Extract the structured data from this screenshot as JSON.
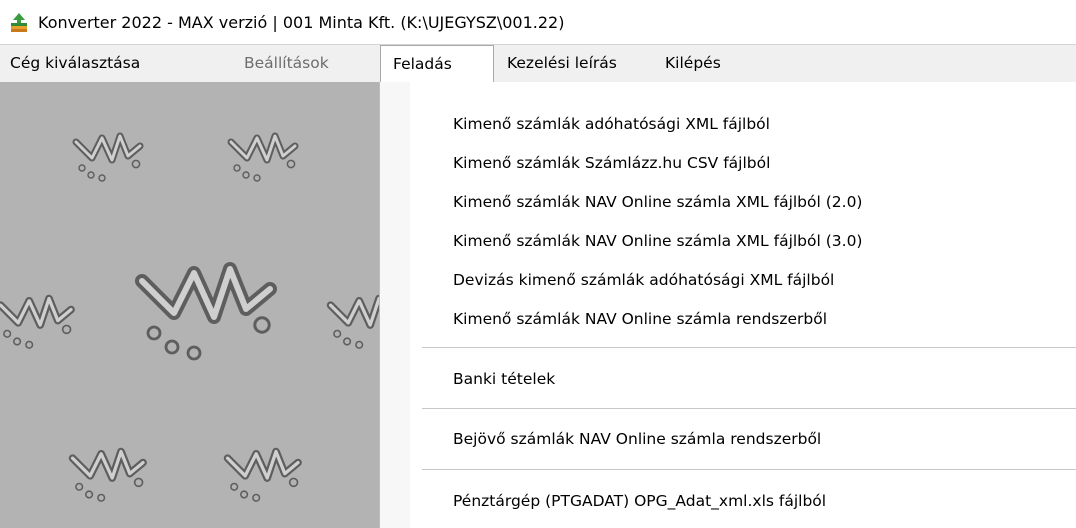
{
  "window": {
    "title": "Konverter 2022 - MAX verzió  | 001 Minta Kft. (K:\\UJEGYSZ\\001.22)",
    "icon": "app-converter-icon"
  },
  "menubar": {
    "items": [
      {
        "label": "Cég kiválasztása",
        "state": "enabled"
      },
      {
        "label": "Beállítások",
        "state": "disabled"
      },
      {
        "label": "Feladás",
        "state": "open"
      },
      {
        "label": "Kezelési leírás",
        "state": "enabled"
      },
      {
        "label": "Kilépés",
        "state": "enabled"
      }
    ]
  },
  "dropdown": {
    "groups": [
      [
        "Kimenő számlák adóhatósági XML fájlból",
        "Kimenő számlák Számlázz.hu CSV fájlból",
        "Kimenő számlák NAV Online számla XML fájlból (2.0)",
        "Kimenő számlák NAV Online számla XML fájlból (3.0)",
        "Devizás kimenő számlák adóhatósági XML fájlból",
        "Kimenő számlák NAV Online számla rendszerből"
      ],
      [
        "Banki tételek"
      ],
      [
        "Bejövő számlák NAV Online számla rendszerből"
      ],
      [
        "Pénztárgép (PTGADAT) OPG_Adat_xml.xls fájlból"
      ]
    ]
  },
  "colors": {
    "background_pattern": "#b3b3b3",
    "logo_gray": "#8a8a8a",
    "menubar": "#f0f0f0",
    "dropdown": "#ffffff"
  }
}
